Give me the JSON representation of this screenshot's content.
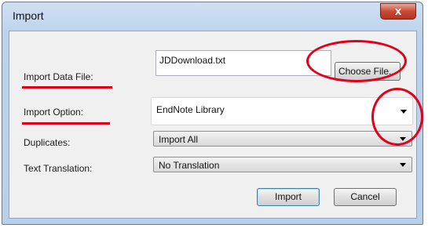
{
  "window": {
    "title": "Import",
    "close_glyph": "x"
  },
  "form": {
    "import_data_file": {
      "label": "Import Data File:",
      "value": "JDDownload.txt",
      "button": "Choose File..."
    },
    "import_option": {
      "label": "Import Option:",
      "selected": "EndNote Library"
    },
    "duplicates": {
      "label": "Duplicates:",
      "selected": "Import All"
    },
    "text_translation": {
      "label": "Text Translation:",
      "selected": "No Translation"
    }
  },
  "actions": {
    "import": "Import",
    "cancel": "Cancel"
  },
  "annotations": {
    "color": "#e3001b",
    "note": "red ovals around Choose File button and dropdown arrow; red underlines under Import Data File and Import Option labels"
  }
}
